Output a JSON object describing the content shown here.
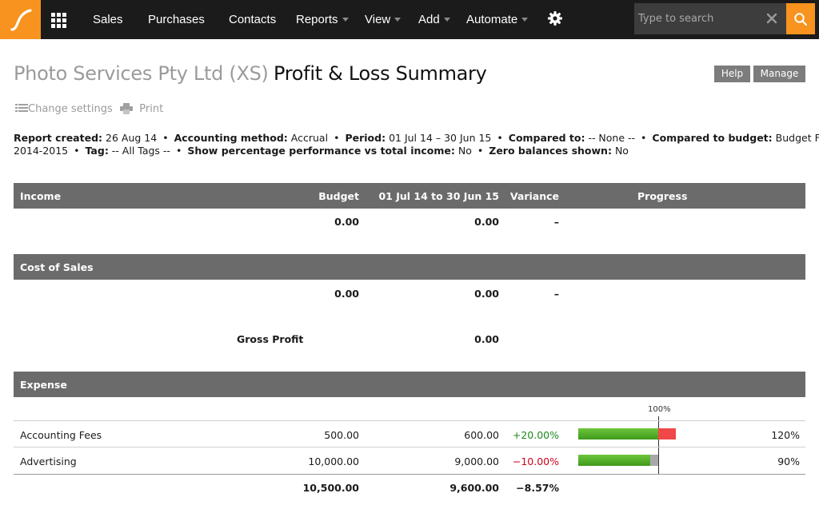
{
  "nav": {
    "items": [
      {
        "label": "Sales",
        "caret": false
      },
      {
        "label": "Purchases",
        "caret": false
      },
      {
        "label": "Contacts",
        "caret": false
      },
      {
        "label": "Reports",
        "caret": true
      },
      {
        "label": "View",
        "caret": true
      },
      {
        "label": "Add",
        "caret": true
      },
      {
        "label": "Automate",
        "caret": true
      }
    ],
    "search_placeholder": "Type to search"
  },
  "header": {
    "company": "Photo Services Pty Ltd (XS)",
    "title": "Profit & Loss Summary",
    "help_label": "Help",
    "manage_label": "Manage"
  },
  "tools": {
    "change_settings": "Change settings",
    "print": "Print"
  },
  "info": {
    "line1": [
      {
        "k": "Report created:",
        "v": "26 Aug 14"
      },
      {
        "k": "Accounting method:",
        "v": "Accrual"
      },
      {
        "k": "Period:",
        "v": "01 Jul 14 – 30 Jun 15"
      },
      {
        "k": "Compared to:",
        "v": "-- None --"
      },
      {
        "k": "Compared to budget:",
        "v": "Budget FY"
      }
    ],
    "line2_lead": "2014-2015",
    "line2": [
      {
        "k": "Tag:",
        "v": "-- All Tags --"
      },
      {
        "k": "Show percentage performance vs total income:",
        "v": "No"
      },
      {
        "k": "Zero balances shown:",
        "v": "No"
      }
    ]
  },
  "table": {
    "columns": {
      "budget": "Budget",
      "period": "01 Jul 14 to 30 Jun 15",
      "variance": "Variance",
      "progress": "Progress"
    },
    "income": {
      "title": "Income",
      "budget": "0.00",
      "actual": "0.00",
      "variance": "–"
    },
    "cost_of_sales": {
      "title": "Cost of Sales",
      "budget": "0.00",
      "actual": "0.00",
      "variance": "–"
    },
    "gross_profit": {
      "label": "Gross Profit",
      "actual": "0.00"
    },
    "expense": {
      "title": "Expense",
      "marker_label": "100%",
      "rows": [
        {
          "name": "Accounting Fees",
          "budget": "500.00",
          "actual": "600.00",
          "variance": "+20.00%",
          "variance_tone": "positive",
          "pct": "120%",
          "progress": 1.2
        },
        {
          "name": "Advertising",
          "budget": "10,000.00",
          "actual": "9,000.00",
          "variance": "−10.00%",
          "variance_tone": "negative",
          "pct": "90%",
          "progress": 0.9
        }
      ],
      "total": {
        "budget": "10,500.00",
        "actual": "9,600.00",
        "variance": "−8.57%"
      }
    }
  },
  "colors": {
    "accent": "#f7931e",
    "topbar": "#1b1b1b",
    "section_header": "#6b6b6b",
    "positive": "#1a8a1a",
    "negative": "#d0021b"
  }
}
